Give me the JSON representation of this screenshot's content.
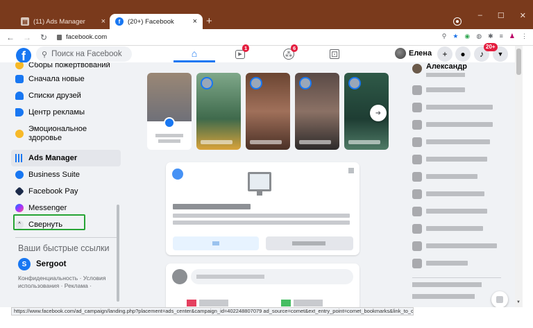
{
  "browser": {
    "tabs": [
      {
        "label": "(11) Ads Manager",
        "close": "×"
      },
      {
        "label": "(20+) Facebook",
        "close": "×"
      }
    ],
    "new_tab": "+",
    "window_controls": [
      "–",
      "☐",
      "✕"
    ],
    "url": "facebook.com",
    "status_url": "https://www.facebook.com/ad_campaign/landing.php?placement=ads_center&campaign_id=402248807079 ad_source=comet&ext_entry_point=comet_bookmarks&link_to_campaign"
  },
  "header": {
    "logo": "f",
    "search_placeholder": "Поиск на Facebook",
    "watch_badge": "1",
    "groups_badge": "6",
    "profile_name": "Елена",
    "notifications_badge": "20+"
  },
  "sidebar": {
    "items": [
      {
        "label": "Сборы пожертвований",
        "icon": "heart-fundraiser-icon",
        "color": "#f7b928"
      },
      {
        "label": "Сначала новые",
        "icon": "newsfeed-icon",
        "color": "#1877f2"
      },
      {
        "label": "Списки друзей",
        "icon": "friends-list-icon",
        "color": "#1877f2"
      },
      {
        "label": "Центр рекламы",
        "icon": "ad-center-icon",
        "color": "#1877f2"
      },
      {
        "label": "Эмоциональное здоровье",
        "icon": "emotional-health-icon",
        "color": "#f7b928"
      },
      {
        "label": "Ads Manager",
        "icon": "ads-manager-icon",
        "color": "#1877f2"
      },
      {
        "label": "Business Suite",
        "icon": "business-suite-icon",
        "color": "#1877f2"
      },
      {
        "label": "Facebook Pay",
        "icon": "facebook-pay-icon",
        "color": "#1c2b4a"
      },
      {
        "label": "Messenger",
        "icon": "messenger-icon",
        "color": "#a033ff"
      },
      {
        "label": "Свернуть",
        "icon": "chevron-up-icon",
        "color": "#e4e6eb"
      }
    ],
    "shortcuts_title": "Ваши быстрые ссылки",
    "shortcut": {
      "label": "Sergoot",
      "initial": "S"
    },
    "legal": "Конфиденциальность · Условия использования · Реклама ·"
  },
  "contacts": {
    "first_name": "Александр"
  },
  "colors": {
    "brand": "#1877f2",
    "chrome_titlebar": "#7a3a1c",
    "highlight_box": "#27a435",
    "badge_red": "#e41e3f"
  }
}
